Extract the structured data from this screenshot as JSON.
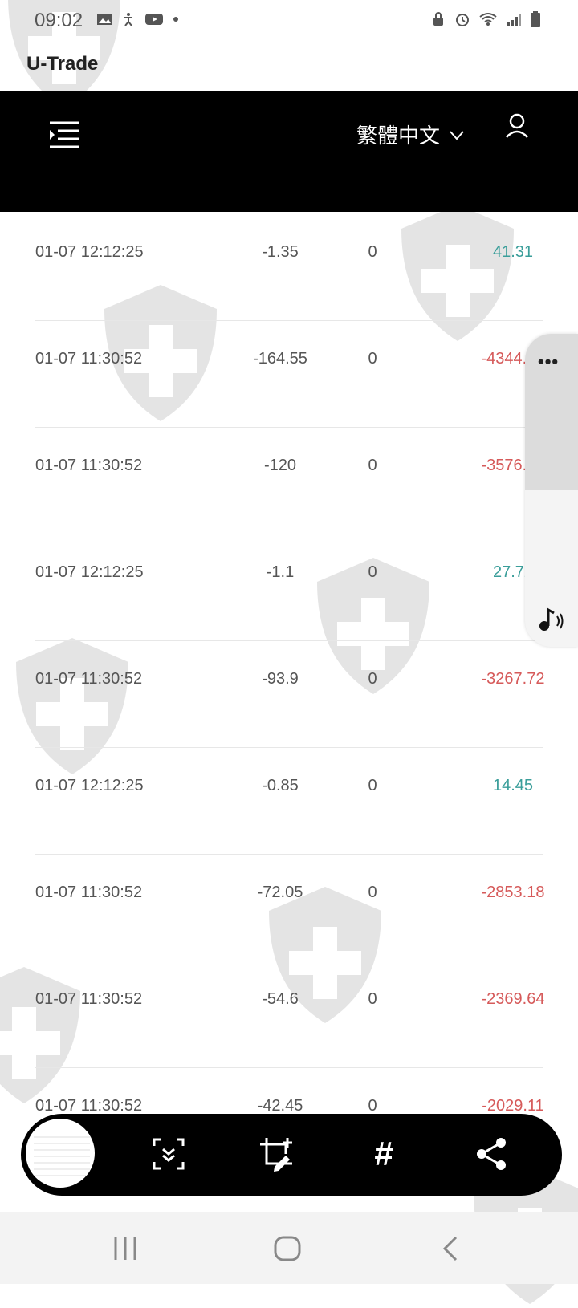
{
  "status_bar": {
    "time": "09:02",
    "left_icons": [
      "image-icon",
      "accessibility-icon",
      "youtube-icon",
      "dot-icon"
    ],
    "right_icons": [
      "lock-icon",
      "alarm-icon",
      "wifi-icon",
      "signal-icon",
      "battery-icon"
    ]
  },
  "app_title": "U-Trade",
  "header": {
    "menu_icon": "menu-icon",
    "language": "繁體中文",
    "language_icon": "chevron-down-icon",
    "user_icon": "user-icon"
  },
  "table": {
    "rows": [
      {
        "time": "01-07 12:12:25",
        "qty": "-1.35",
        "zero": "0",
        "pl": "41.31",
        "positive": true
      },
      {
        "time": "01-07 11:30:52",
        "qty": "-164.55",
        "zero": "0",
        "pl": "-4344.12",
        "positive": false
      },
      {
        "time": "01-07 11:30:52",
        "qty": "-120",
        "zero": "0",
        "pl": "-3576.00",
        "positive": false
      },
      {
        "time": "01-07 12:12:25",
        "qty": "-1.1",
        "zero": "0",
        "pl": "27.72",
        "positive": true
      },
      {
        "time": "01-07 11:30:52",
        "qty": "-93.9",
        "zero": "0",
        "pl": "-3267.72",
        "positive": false
      },
      {
        "time": "01-07 12:12:25",
        "qty": "-0.85",
        "zero": "0",
        "pl": "14.45",
        "positive": true
      },
      {
        "time": "01-07 11:30:52",
        "qty": "-72.05",
        "zero": "0",
        "pl": "-2853.18",
        "positive": false
      },
      {
        "time": "01-07 11:30:52",
        "qty": "-54.6",
        "zero": "0",
        "pl": "-2369.64",
        "positive": false
      },
      {
        "time": "01-07 11:30:52",
        "qty": "-42.45",
        "zero": "0",
        "pl": "-2029.11",
        "positive": false
      }
    ]
  },
  "side_panel": {
    "more_label": "•••",
    "music_icon": "music-note-icon"
  },
  "capture_toolbar": {
    "tools": [
      "scroll-capture-icon",
      "crop-edit-icon",
      "hashtag-icon",
      "share-icon"
    ],
    "hashtag_symbol": "#"
  },
  "nav_bar": {
    "buttons": [
      "recent-apps-icon",
      "home-icon",
      "back-icon"
    ]
  },
  "colors": {
    "positive": "#3a9e9a",
    "negative": "#d65a5a",
    "header_bg": "#000000"
  }
}
